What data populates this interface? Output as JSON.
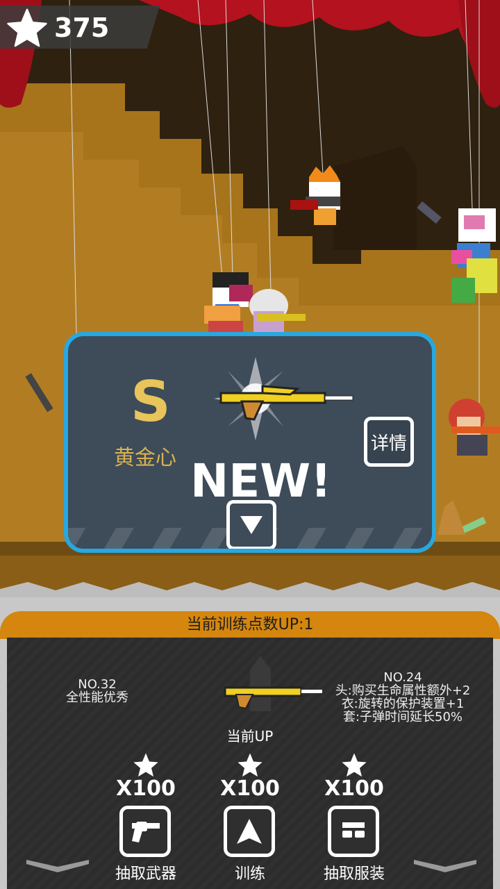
{
  "hud": {
    "star_count": "375"
  },
  "popup": {
    "rank": "S",
    "weapon_name": "黄金心",
    "new_label": "NEW!",
    "detail_label": "详情"
  },
  "panel": {
    "header": "当前训练点数UP:1",
    "left_info": {
      "no": "NO.32",
      "desc": "全性能优秀"
    },
    "center_label": "当前UP",
    "right_info": {
      "no": "NO.24",
      "lines": [
        "头:购买生命属性额外+2",
        "衣:旋转的保护装置+1",
        "套:子弹时间延长50%"
      ]
    },
    "actions": [
      {
        "cost": "X100",
        "label": "抽取武器",
        "icon": "revolver-icon"
      },
      {
        "cost": "X100",
        "label": "训练",
        "icon": "up-arrow-icon"
      },
      {
        "cost": "X100",
        "label": "抽取服装",
        "icon": "glasses-icon"
      }
    ]
  },
  "colors": {
    "popup_border": "#27a8e0",
    "header_bar": "#d4860e",
    "rank_gold": "#e8c45a"
  }
}
